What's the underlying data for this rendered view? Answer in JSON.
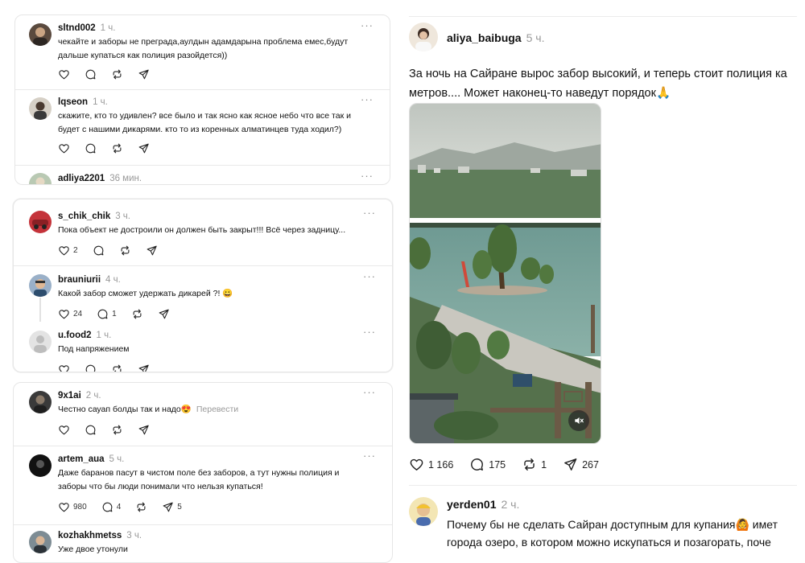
{
  "left_panels": {
    "panel_a": {
      "posts": [
        {
          "username": "sltnd002",
          "time": "1 ч.",
          "lines": [
            "чекайте и заборы не преграда,аулдын адамдарына проблема емес,будут",
            "дальше купаться как полиция разойдется))"
          ]
        },
        {
          "username": "lqseon",
          "time": "1 ч.",
          "lines": [
            "скажите, кто то удивлен? все было и так ясно как ясное небо что все так и",
            "будет с нашими дикарями. кто то из коренных алматинцев туда ходил?)"
          ]
        },
        {
          "username": "adliya2201",
          "time": "36 мин."
        }
      ]
    },
    "panel_b": {
      "posts": [
        {
          "username": "s_chik_chik",
          "time": "3 ч.",
          "text": "Пока объект не достроили он должен быть закрыт!!! Всё через задницу...",
          "likes": "2"
        },
        {
          "username": "brauniurii",
          "time": "4 ч.",
          "text": "Какой забор сможет удержать дикарей ?! 😀",
          "likes": "24",
          "replies": "1"
        },
        {
          "username": "u.food2",
          "time": "1 ч.",
          "text": "Под напряжением"
        }
      ]
    },
    "panel_c": {
      "posts": [
        {
          "username": "9x1ai",
          "time": "2 ч.",
          "text": "Честно сауап болды так и надо😍",
          "translate": "Перевести"
        },
        {
          "username": "artem_aua",
          "time": "5 ч.",
          "lines": [
            "Даже баранов пасут в чистом поле без заборов, а тут нужны полиция и",
            "заборы что бы люди понимали что нельзя купаться!"
          ],
          "likes": "980",
          "replies": "4",
          "shares": "5"
        },
        {
          "username": "kozhakhmetss",
          "time": "3 ч.",
          "text": "Уже двое утонули"
        }
      ]
    }
  },
  "main_post": {
    "username": "aliya_baibuga",
    "time": "5 ч.",
    "lines": [
      "За ночь на Сайране вырос забор высокий, и теперь стоит полиция ка",
      "метров.... Может наконец-то наведут порядок🙏"
    ],
    "likes": "1 166",
    "replies": "175",
    "reposts": "1",
    "shares": "267"
  },
  "reply_post": {
    "username": "yerden01",
    "time": "2 ч.",
    "lines": [
      "Почему бы не сделать Сайран доступным для купания🙆 имет",
      "города озеро, в котором можно искупаться и позагорать, поче"
    ]
  },
  "icons": {
    "more": "more-icon",
    "like": "heart-icon",
    "reply": "comment-icon",
    "repost": "repost-icon",
    "share": "send-icon",
    "mute": "mute-icon"
  },
  "colors": {
    "text": "#111111",
    "muted": "#999999",
    "separator": "#e9e9e9"
  }
}
